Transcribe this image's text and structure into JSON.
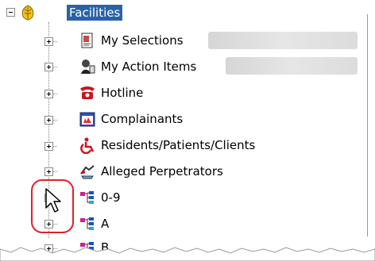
{
  "tree": {
    "root": {
      "label": "Facilities",
      "icon": "leaf-icon",
      "expanded": true
    },
    "items": [
      {
        "label": "My Selections",
        "icon": "selections-doc-icon"
      },
      {
        "label": "My Action Items",
        "icon": "action-items-icon"
      },
      {
        "label": "Hotline",
        "icon": "telephone-icon"
      },
      {
        "label": "Complainants",
        "icon": "calendar-complainants-icon"
      },
      {
        "label": "Residents/Patients/Clients",
        "icon": "wheelchair-icon"
      },
      {
        "label": "Alleged Perpetrators",
        "icon": "perpetrator-icon"
      },
      {
        "label": "0-9",
        "icon": "org-chart-icon"
      },
      {
        "label": "A",
        "icon": "org-chart-icon"
      },
      {
        "label": "B",
        "icon": "org-chart-icon"
      }
    ]
  },
  "colors": {
    "selection": "#2a63a5",
    "highlight_ring": "#e0202a"
  }
}
